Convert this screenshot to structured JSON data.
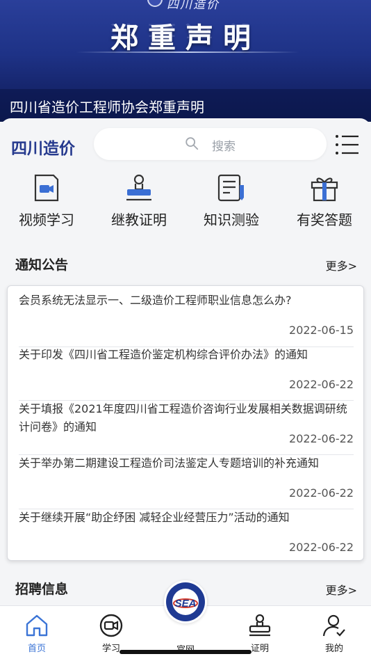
{
  "banner": {
    "top_text": "四川造价",
    "headline": "郑重声明",
    "caption": "四川省造价工程师协会郑重声明"
  },
  "header": {
    "brand": "四川造价",
    "search_placeholder": "搜索"
  },
  "quick_actions": [
    {
      "label": "视频学习",
      "icon": "video-icon"
    },
    {
      "label": "继教证明",
      "icon": "stamp-icon"
    },
    {
      "label": "知识测验",
      "icon": "quiz-icon"
    },
    {
      "label": "有奖答题",
      "icon": "gift-icon"
    }
  ],
  "notices": {
    "title": "通知公告",
    "more": "更多>",
    "items": [
      {
        "title": "会员系统无法显示一、二级造价工程师职业信息怎么办?",
        "date": "2022-06-15"
      },
      {
        "title": "关于印发《四川省工程造价鉴定机构综合评价办法》的通知",
        "date": "2022-06-22"
      },
      {
        "title": "关于填报《2021年度四川省工程造价咨询行业发展相关数据调研统计问卷》的通知",
        "date": "2022-06-22"
      },
      {
        "title": "关于举办第二期建设工程造价司法鉴定人专题培训的补充通知",
        "date": "2022-06-22"
      },
      {
        "title": "关于继续开展“助企纾困 减轻企业经营压力”活动的通知",
        "date": "2022-06-22"
      }
    ]
  },
  "recruit": {
    "title": "招聘信息",
    "more": "更多>"
  },
  "tabbar": {
    "items": [
      {
        "label": "首页",
        "icon": "home-icon",
        "active": true
      },
      {
        "label": "学习",
        "icon": "video-circle-icon",
        "active": false
      },
      {
        "label": "官网",
        "icon": "association-logo-icon",
        "active": false
      },
      {
        "label": "证明",
        "icon": "stamp-icon",
        "active": false
      },
      {
        "label": "我的",
        "icon": "user-icon",
        "active": false
      }
    ],
    "logo_text": "SEA"
  },
  "colors": {
    "brand_blue": "#263a8e",
    "banner_blue": "#1e3286",
    "active_tab": "#3b74d6",
    "icon_accent": "#3b6fd4"
  }
}
